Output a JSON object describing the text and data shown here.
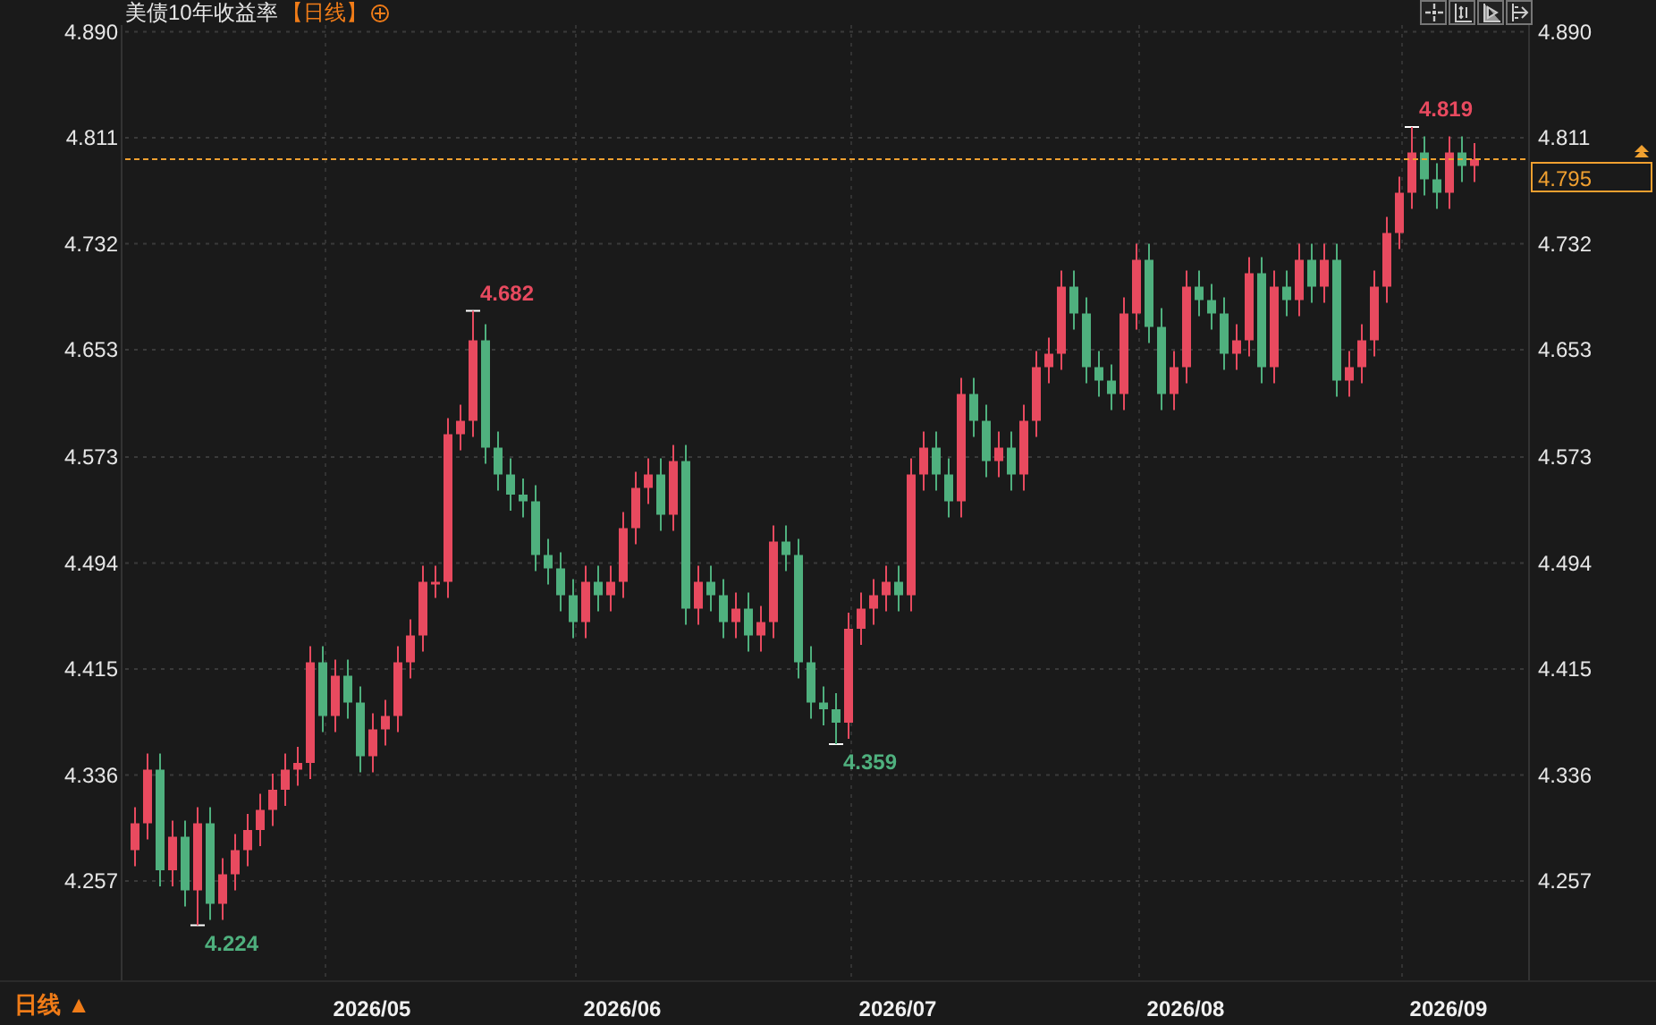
{
  "header": {
    "title": "美债10年收益率",
    "period_tag": "【日线】"
  },
  "toolbar": {
    "buttons": [
      {
        "kind": "crosshair"
      },
      {
        "kind": "price-range"
      },
      {
        "kind": "time-range"
      },
      {
        "kind": "exit"
      }
    ]
  },
  "chart": {
    "chart_data": {
      "type": "candlestick",
      "grid": true,
      "ylim": [
        4.183,
        4.895
      ],
      "yticks": [
        {
          "value": 4.89,
          "label": "4.890"
        },
        {
          "value": 4.811,
          "label": "4.811"
        },
        {
          "value": 4.732,
          "label": "4.732"
        },
        {
          "value": 4.653,
          "label": "4.653"
        },
        {
          "value": 4.573,
          "label": "4.573"
        },
        {
          "value": 4.494,
          "label": "4.494"
        },
        {
          "value": 4.415,
          "label": "4.415"
        },
        {
          "value": 4.336,
          "label": "4.336"
        },
        {
          "value": 4.257,
          "label": "4.257"
        }
      ],
      "categories": [
        null,
        null,
        null,
        null,
        null,
        null,
        null,
        null,
        null,
        null,
        null,
        null,
        null,
        null,
        null,
        null,
        null,
        null,
        null,
        "2026/05",
        null,
        null,
        null,
        null,
        null,
        null,
        null,
        null,
        null,
        null,
        null,
        null,
        null,
        null,
        null,
        null,
        null,
        null,
        null,
        "2026/06",
        null,
        null,
        null,
        null,
        null,
        null,
        null,
        null,
        null,
        null,
        null,
        null,
        null,
        null,
        null,
        null,
        null,
        null,
        null,
        null,
        null,
        "2026/07",
        null,
        null,
        null,
        null,
        null,
        null,
        null,
        null,
        null,
        null,
        null,
        null,
        null,
        null,
        null,
        null,
        null,
        null,
        null,
        null,
        null,
        null,
        "2026/08",
        null,
        null,
        null,
        null,
        null,
        null,
        null,
        null,
        null,
        null,
        null,
        null,
        null,
        null,
        null,
        null,
        null,
        null,
        null,
        null,
        "2026/09",
        null,
        null
      ],
      "ohlc": [
        [
          4.28,
          4.312,
          4.268,
          4.3
        ],
        [
          4.3,
          4.352,
          4.288,
          4.34
        ],
        [
          4.34,
          4.352,
          4.253,
          4.265
        ],
        [
          4.265,
          4.302,
          4.253,
          4.29
        ],
        [
          4.29,
          4.302,
          4.238,
          4.25
        ],
        [
          4.25,
          4.312,
          4.224,
          4.3
        ],
        [
          4.3,
          4.312,
          4.228,
          4.24
        ],
        [
          4.24,
          4.274,
          4.228,
          4.262
        ],
        [
          4.262,
          4.292,
          4.25,
          4.28
        ],
        [
          4.28,
          4.307,
          4.268,
          4.295
        ],
        [
          4.295,
          4.322,
          4.283,
          4.31
        ],
        [
          4.31,
          4.337,
          4.298,
          4.325
        ],
        [
          4.325,
          4.352,
          4.313,
          4.34
        ],
        [
          4.34,
          4.357,
          4.328,
          4.345
        ],
        [
          4.345,
          4.432,
          4.333,
          4.42
        ],
        [
          4.42,
          4.432,
          4.368,
          4.38
        ],
        [
          4.38,
          4.422,
          4.368,
          4.41
        ],
        [
          4.41,
          4.422,
          4.378,
          4.39
        ],
        [
          4.39,
          4.402,
          4.338,
          4.35
        ],
        [
          4.35,
          4.382,
          4.338,
          4.37
        ],
        [
          4.37,
          4.392,
          4.358,
          4.38
        ],
        [
          4.38,
          4.432,
          4.368,
          4.42
        ],
        [
          4.42,
          4.452,
          4.408,
          4.44
        ],
        [
          4.44,
          4.492,
          4.428,
          4.48
        ],
        [
          4.48,
          4.492,
          4.468,
          4.48
        ],
        [
          4.48,
          4.602,
          4.468,
          4.59
        ],
        [
          4.59,
          4.612,
          4.578,
          4.6
        ],
        [
          4.6,
          4.682,
          4.588,
          4.66
        ],
        [
          4.66,
          4.672,
          4.568,
          4.58
        ],
        [
          4.58,
          4.592,
          4.548,
          4.56
        ],
        [
          4.56,
          4.572,
          4.533,
          4.545
        ],
        [
          4.545,
          4.557,
          4.528,
          4.54
        ],
        [
          4.54,
          4.552,
          4.488,
          4.5
        ],
        [
          4.5,
          4.512,
          4.478,
          4.49
        ],
        [
          4.49,
          4.502,
          4.458,
          4.47
        ],
        [
          4.47,
          4.482,
          4.438,
          4.45
        ],
        [
          4.45,
          4.492,
          4.438,
          4.48
        ],
        [
          4.48,
          4.492,
          4.458,
          4.47
        ],
        [
          4.47,
          4.492,
          4.458,
          4.48
        ],
        [
          4.48,
          4.532,
          4.468,
          4.52
        ],
        [
          4.52,
          4.562,
          4.508,
          4.55
        ],
        [
          4.55,
          4.572,
          4.538,
          4.56
        ],
        [
          4.56,
          4.572,
          4.518,
          4.53
        ],
        [
          4.53,
          4.582,
          4.518,
          4.57
        ],
        [
          4.57,
          4.582,
          4.448,
          4.46
        ],
        [
          4.46,
          4.492,
          4.448,
          4.48
        ],
        [
          4.48,
          4.492,
          4.458,
          4.47
        ],
        [
          4.47,
          4.482,
          4.438,
          4.45
        ],
        [
          4.45,
          4.472,
          4.438,
          4.46
        ],
        [
          4.46,
          4.472,
          4.428,
          4.44
        ],
        [
          4.44,
          4.462,
          4.428,
          4.45
        ],
        [
          4.45,
          4.522,
          4.438,
          4.51
        ],
        [
          4.51,
          4.522,
          4.488,
          4.5
        ],
        [
          4.5,
          4.512,
          4.408,
          4.42
        ],
        [
          4.42,
          4.432,
          4.378,
          4.39
        ],
        [
          4.39,
          4.402,
          4.373,
          4.385
        ],
        [
          4.385,
          4.397,
          4.359,
          4.375
        ],
        [
          4.375,
          4.457,
          4.363,
          4.445
        ],
        [
          4.445,
          4.472,
          4.433,
          4.46
        ],
        [
          4.46,
          4.482,
          4.448,
          4.47
        ],
        [
          4.47,
          4.492,
          4.458,
          4.48
        ],
        [
          4.48,
          4.492,
          4.458,
          4.47
        ],
        [
          4.47,
          4.572,
          4.458,
          4.56
        ],
        [
          4.56,
          4.592,
          4.548,
          4.58
        ],
        [
          4.58,
          4.592,
          4.548,
          4.56
        ],
        [
          4.56,
          4.572,
          4.528,
          4.54
        ],
        [
          4.54,
          4.632,
          4.528,
          4.62
        ],
        [
          4.62,
          4.632,
          4.588,
          4.6
        ],
        [
          4.6,
          4.612,
          4.558,
          4.57
        ],
        [
          4.57,
          4.592,
          4.558,
          4.58
        ],
        [
          4.58,
          4.592,
          4.548,
          4.56
        ],
        [
          4.56,
          4.612,
          4.548,
          4.6
        ],
        [
          4.6,
          4.652,
          4.588,
          4.64
        ],
        [
          4.64,
          4.662,
          4.628,
          4.65
        ],
        [
          4.65,
          4.712,
          4.638,
          4.7
        ],
        [
          4.7,
          4.712,
          4.668,
          4.68
        ],
        [
          4.68,
          4.692,
          4.628,
          4.64
        ],
        [
          4.64,
          4.652,
          4.618,
          4.63
        ],
        [
          4.63,
          4.642,
          4.608,
          4.62
        ],
        [
          4.62,
          4.692,
          4.608,
          4.68
        ],
        [
          4.68,
          4.732,
          4.668,
          4.72
        ],
        [
          4.72,
          4.732,
          4.658,
          4.67
        ],
        [
          4.67,
          4.684,
          4.608,
          4.62
        ],
        [
          4.62,
          4.652,
          4.608,
          4.64
        ],
        [
          4.64,
          4.712,
          4.628,
          4.7
        ],
        [
          4.7,
          4.712,
          4.678,
          4.69
        ],
        [
          4.69,
          4.702,
          4.668,
          4.68
        ],
        [
          4.68,
          4.692,
          4.638,
          4.65
        ],
        [
          4.65,
          4.672,
          4.638,
          4.66
        ],
        [
          4.66,
          4.722,
          4.648,
          4.71
        ],
        [
          4.71,
          4.722,
          4.628,
          4.64
        ],
        [
          4.64,
          4.712,
          4.628,
          4.7
        ],
        [
          4.7,
          4.712,
          4.678,
          4.69
        ],
        [
          4.69,
          4.732,
          4.678,
          4.72
        ],
        [
          4.72,
          4.732,
          4.688,
          4.7
        ],
        [
          4.7,
          4.732,
          4.688,
          4.72
        ],
        [
          4.72,
          4.732,
          4.618,
          4.63
        ],
        [
          4.63,
          4.652,
          4.618,
          4.64
        ],
        [
          4.64,
          4.672,
          4.628,
          4.66
        ],
        [
          4.66,
          4.712,
          4.648,
          4.7
        ],
        [
          4.7,
          4.752,
          4.688,
          4.74
        ],
        [
          4.74,
          4.782,
          4.728,
          4.77
        ],
        [
          4.77,
          4.819,
          4.758,
          4.8
        ],
        [
          4.8,
          4.812,
          4.768,
          4.78
        ],
        [
          4.78,
          4.792,
          4.758,
          4.77
        ],
        [
          4.77,
          4.812,
          4.758,
          4.8
        ],
        [
          4.8,
          4.812,
          4.778,
          4.79
        ],
        [
          4.79,
          4.807,
          4.778,
          4.795
        ]
      ],
      "ref_lines": [
        {
          "axis": "y",
          "value": 4.795,
          "label": "4.795"
        }
      ],
      "annotations": [
        "4.224",
        "4.682",
        "4.359",
        "4.819"
      ]
    },
    "right_axis_labels": [
      "4.890",
      "4.811",
      "4.732",
      "4.653",
      "4.573",
      "4.494",
      "4.415",
      "4.336",
      "4.257"
    ]
  },
  "footer": {
    "period_button": "日线 ▲"
  }
}
